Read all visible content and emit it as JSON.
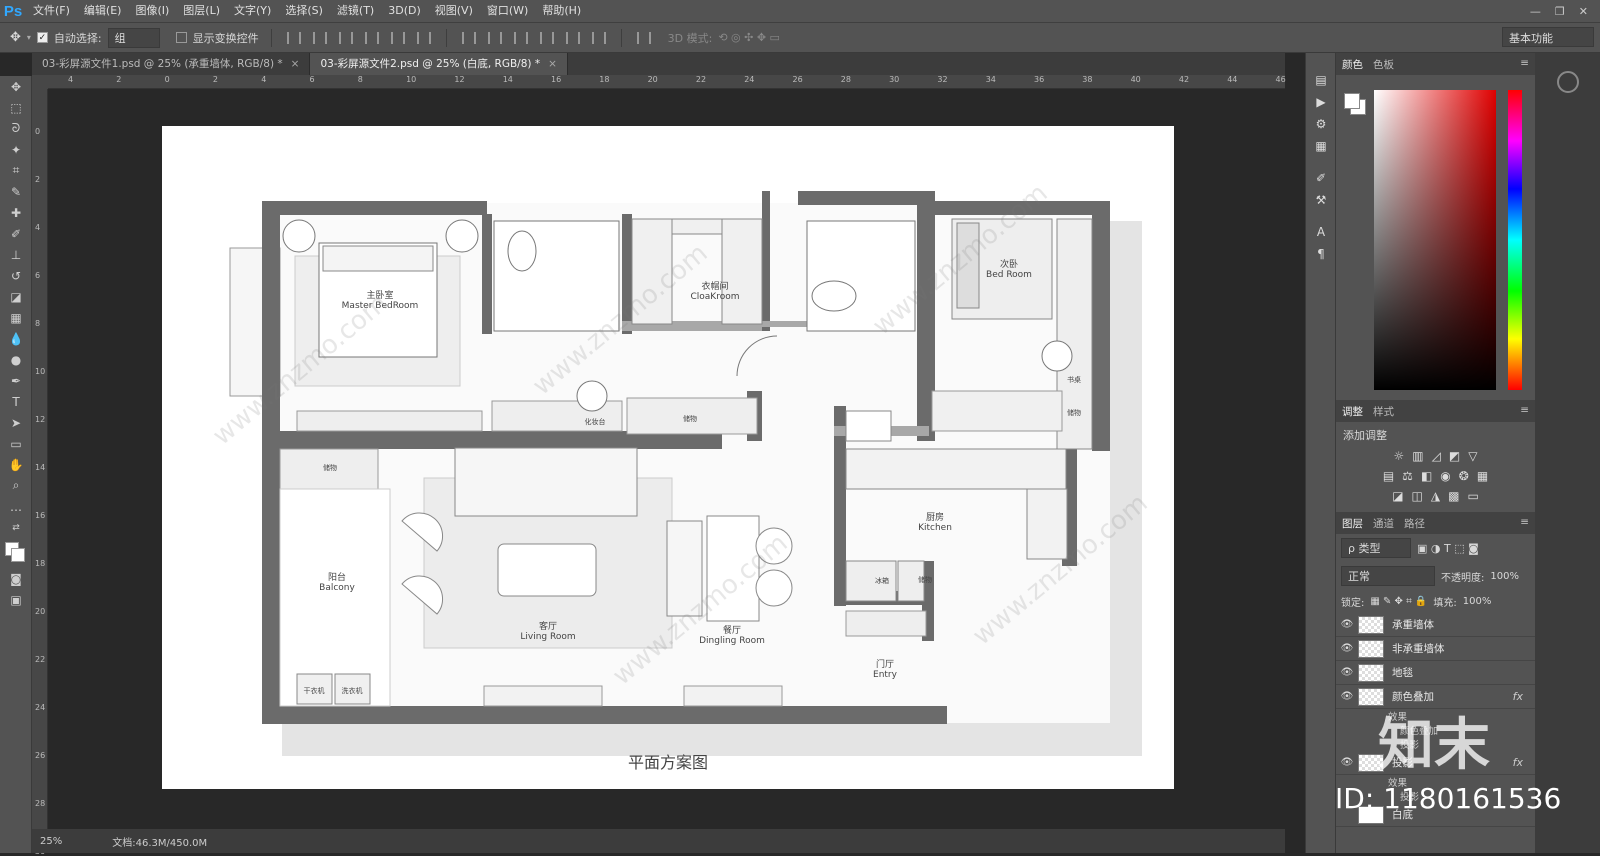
{
  "app": {
    "logo": "Ps"
  },
  "menu": [
    "文件(F)",
    "编辑(E)",
    "图像(I)",
    "图层(L)",
    "文字(Y)",
    "选择(S)",
    "滤镜(T)",
    "3D(D)",
    "视图(V)",
    "窗口(W)",
    "帮助(H)"
  ],
  "options": {
    "auto_select_label": "自动选择:",
    "auto_select_value": "组",
    "show_transform_label": "显示变换控件",
    "mode3d_label": "3D 模式:",
    "workspace": "基本功能"
  },
  "tabs": [
    {
      "label": "03-彩屏源文件1.psd @ 25% (承重墙体, RGB/8) *"
    },
    {
      "label": "03-彩屏源文件2.psd @ 25% (白底, RGB/8) *"
    }
  ],
  "ruler_h": [
    "4",
    "2",
    "0",
    "2",
    "4",
    "6",
    "8",
    "10",
    "12",
    "14",
    "16",
    "18",
    "20",
    "22",
    "24",
    "26",
    "28",
    "30",
    "32",
    "34",
    "36",
    "38",
    "40",
    "42",
    "44",
    "46"
  ],
  "ruler_v": [
    "0",
    "2",
    "4",
    "6",
    "8",
    "10",
    "12",
    "14",
    "16",
    "18",
    "20",
    "22",
    "24",
    "26",
    "28",
    "30"
  ],
  "floorplan": {
    "title": "平面方案图",
    "rooms": {
      "master_cn": "主卧室",
      "master_en": "Master BedRoom",
      "cloak_cn": "衣帽间",
      "cloak_en": "CloaKroom",
      "second_cn": "次卧",
      "second_en": "Bed Room",
      "desk": "书桌",
      "storage": "储物",
      "vanity": "化妆台",
      "balcony_cn": "阳台",
      "balcony_en": "Balcony",
      "living_cn": "客厅",
      "living_en": "Living  Room",
      "dining_cn": "餐厅",
      "dining_en": "Dingling Room",
      "kitchen_cn": "厨房",
      "kitchen_en": "Kitchen",
      "fridge": "冰箱",
      "entry_cn": "门厅",
      "entry_en": "Entry",
      "dryer": "干衣机",
      "washer": "洗衣机"
    },
    "watermark": "www.znzmo.com"
  },
  "status": {
    "zoom": "25%",
    "doc": "文档:46.3M/450.0M"
  },
  "panels": {
    "color_tabs": [
      "颜色",
      "色板"
    ],
    "adjust_tabs": [
      "调整",
      "样式"
    ],
    "adjust_label": "添加调整",
    "layer_tabs": [
      "图层",
      "通道",
      "路径"
    ],
    "filter_kind": "ρ 类型",
    "blend_mode": "正常",
    "opacity_label": "不透明度:",
    "opacity": "100%",
    "lock_label": "锁定:",
    "fill_label": "填充:",
    "fill": "100%",
    "layers": [
      {
        "name": "承重墙体"
      },
      {
        "name": "非承重墙体"
      },
      {
        "name": "地毯"
      },
      {
        "name": "颜色叠加",
        "fx": "fx"
      },
      {
        "name": "投影",
        "fx": "fx"
      },
      {
        "name": "白底"
      }
    ],
    "effects_label": "效果",
    "effect_color_overlay": "颜色叠加",
    "effect_shadow": "投影"
  },
  "overlay": {
    "brand": "知末",
    "id": "ID: 1180161536"
  }
}
